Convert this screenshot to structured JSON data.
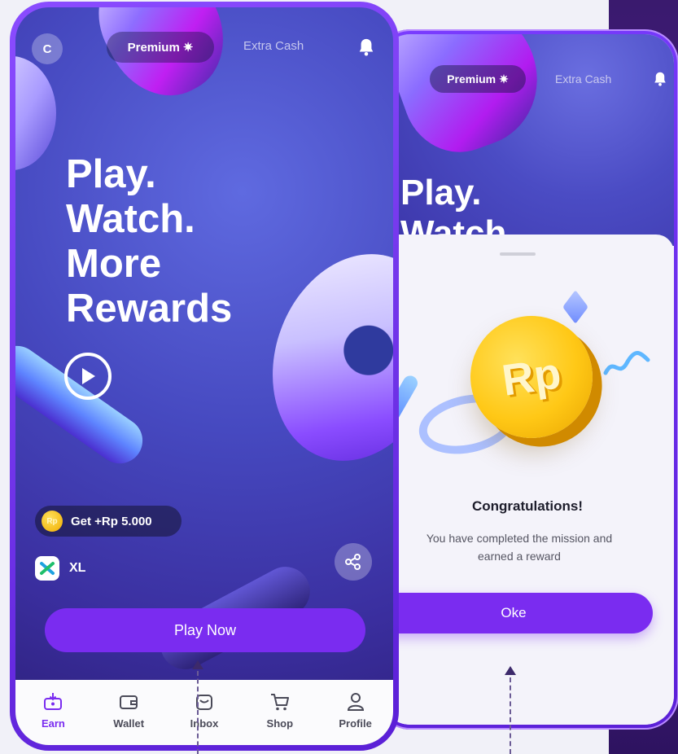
{
  "phone_main": {
    "avatar_initial": "C",
    "tabs": {
      "premium": "Premium",
      "extra_cash": "Extra Cash"
    },
    "headline": [
      "Play.",
      "Watch.",
      "More",
      "Rewards"
    ],
    "reward_badge": "Get +Rp 5.000",
    "reward_coin_label": "Rp",
    "provider_name": "XL",
    "cta_label": "Play Now",
    "nav": [
      {
        "label": "Earn",
        "icon": "earn-icon",
        "active": true
      },
      {
        "label": "Wallet",
        "icon": "wallet-icon",
        "active": false
      },
      {
        "label": "Inbox",
        "icon": "inbox-icon",
        "active": false
      },
      {
        "label": "Shop",
        "icon": "cart-icon",
        "active": false
      },
      {
        "label": "Profile",
        "icon": "profile-icon",
        "active": false
      }
    ]
  },
  "phone_dialog": {
    "tabs": {
      "premium": "Premium",
      "extra_cash": "Extra Cash"
    },
    "headline": [
      "Play.",
      "Watch"
    ],
    "coin_label": "Rp",
    "dialog_title": "Congratulations!",
    "dialog_message": "You have completed the mission and earned a reward",
    "ok_button": "Oke"
  },
  "colors": {
    "accent": "#7a2cf0",
    "hero_bg": "#4649c0",
    "coin": "#ffc816",
    "frame": "#7a3cff"
  }
}
